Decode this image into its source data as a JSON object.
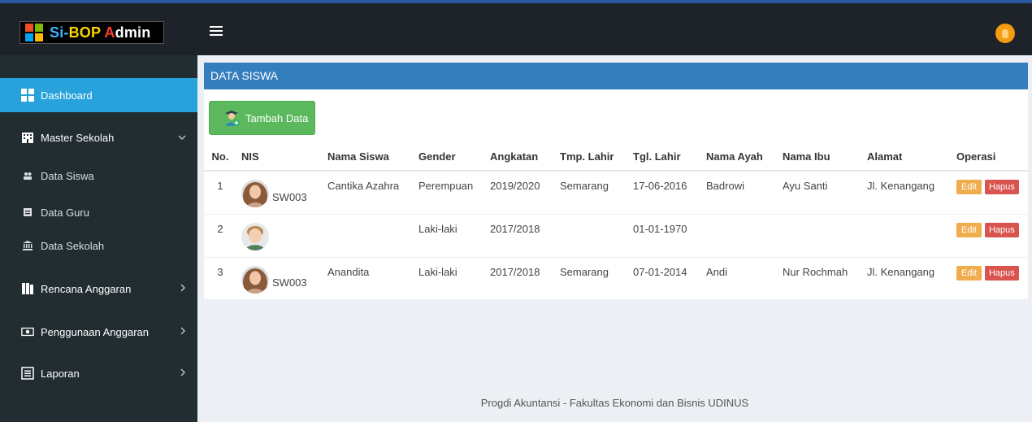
{
  "brand": {
    "part1": "Si-",
    "part2": "BOP",
    "part3": " A",
    "part4": "dmin"
  },
  "sidebar": {
    "items": [
      {
        "label": "Dashboard",
        "icon": "dashboard-icon",
        "active": true
      },
      {
        "label": "Master Sekolah",
        "icon": "building-icon",
        "chevron": "v"
      },
      {
        "label": "Data Siswa",
        "icon": "users-icon",
        "sub": true
      },
      {
        "label": "Data Guru",
        "icon": "id-card-icon",
        "sub": true
      },
      {
        "label": "Data Sekolah",
        "icon": "bank-icon",
        "sub": true
      },
      {
        "label": "Rencana Anggaran",
        "icon": "book-icon",
        "chevron": ">"
      },
      {
        "label": "Penggunaan Anggaran",
        "icon": "money-icon",
        "chevron": ">"
      },
      {
        "label": "Laporan",
        "icon": "list-icon",
        "chevron": ">"
      }
    ]
  },
  "panel": {
    "title": "DATA SISWA",
    "add_button": "Tambah Data"
  },
  "table": {
    "headers": [
      "No.",
      "NIS",
      "Nama Siswa",
      "Gender",
      "Angkatan",
      "Tmp. Lahir",
      "Tgl. Lahir",
      "Nama Ayah",
      "Nama Ibu",
      "Alamat",
      "Operasi"
    ],
    "rows": [
      {
        "no": "1",
        "nis": "SW003",
        "nama": "Cantika Azahra",
        "gender": "Perempuan",
        "angkatan": "2019/2020",
        "tmp": "Semarang",
        "tgl": "17-06-2016",
        "ayah": "Badrowi",
        "ibu": "Ayu Santi",
        "alamat": "Jl. Kenangang",
        "avatar": "girl"
      },
      {
        "no": "2",
        "nis": "",
        "nama": "",
        "gender": "Laki-laki",
        "angkatan": "2017/2018",
        "tmp": "",
        "tgl": "01-01-1970",
        "ayah": "",
        "ibu": "",
        "alamat": "",
        "avatar": "boy"
      },
      {
        "no": "3",
        "nis": "SW003",
        "nama": "Anandita",
        "gender": "Laki-laki",
        "angkatan": "2017/2018",
        "tmp": "Semarang",
        "tgl": "07-01-2014",
        "ayah": "Andi",
        "ibu": "Nur Rochmah",
        "alamat": "Jl. Kenangang",
        "avatar": "girl"
      }
    ],
    "edit_label": "Edit",
    "delete_label": "Hapus"
  },
  "footer": "Progdi Akuntansi - Fakultas Ekonomi dan Bisnis UDINUS",
  "colors": {
    "topbar": "#1e2329",
    "sidebar": "#222d32",
    "active": "#27a2db",
    "panel_header": "#357ebd",
    "add_button": "#5cb85c",
    "edit": "#f0ad4e",
    "delete": "#d9534f"
  }
}
